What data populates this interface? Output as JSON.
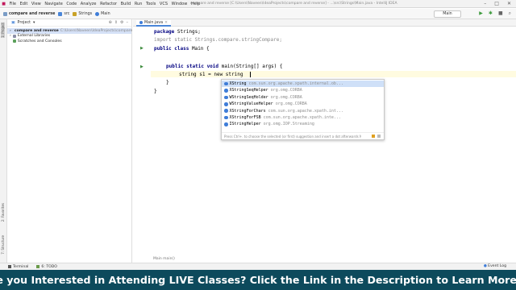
{
  "titlebar": {
    "menu": [
      "File",
      "Edit",
      "View",
      "Navigate",
      "Code",
      "Analyze",
      "Refactor",
      "Build",
      "Run",
      "Tools",
      "VCS",
      "Window",
      "Help"
    ],
    "window_title": "compare and reverse [C:\\Users\\Naveen\\IdeaProjects\\compare and reverse] - ...\\src\\Strings\\Main.java - IntelliJ IDEA"
  },
  "navbar": {
    "crumbs": [
      "compare and reverse",
      "src",
      "Strings",
      "Main"
    ],
    "run_config": "Main"
  },
  "left_tools": {
    "project": "1: Project",
    "structure": "7: Structure",
    "favorites": "2: Favorites"
  },
  "project_panel": {
    "header": "Project",
    "items": [
      {
        "label": "compare and reverse",
        "detail": "C:\\Users\\Naveen\\IdeaProjects\\compare and reverse",
        "selected": true
      },
      {
        "label": "External Libraries"
      },
      {
        "label": "Scratches and Consoles"
      }
    ]
  },
  "editor": {
    "tab_label": "Main.java",
    "code": {
      "line1_kw": "package",
      "line1_rest": " Strings;",
      "line2": "import static Strings.compare.stringCompare;",
      "line3_kw": "public class",
      "line3_rest": " Main {",
      "line4_kw": "public static void",
      "line4_rest": " main(String[] args) {",
      "line5": "string s1 = new string",
      "line6": "}",
      "line7": "}"
    }
  },
  "autocomplete": {
    "items": [
      {
        "name": "XString",
        "pkg": "com.sun.org.apache.xpath.internal.ob..."
      },
      {
        "name": "XStringSeqHelper",
        "pkg": "org.omg.CORBA"
      },
      {
        "name": "WStringSeqHolder",
        "pkg": "org.omg.CORBA"
      },
      {
        "name": "WStringValueHelper",
        "pkg": "org.omg.CORBA"
      },
      {
        "name": "XStringForChars",
        "pkg": "com.sun.org.apache.xpath.int..."
      },
      {
        "name": "XStringForFSB",
        "pkg": "com.sun.org.apache.xpath.inte..."
      },
      {
        "name": "IStringHelper",
        "pkg": "org.omg.IOP.Streaming"
      }
    ],
    "footer": "Press Ctrl+. to choose the selected (or first) suggestion and insert a dot afterwards  Next Tip"
  },
  "editor_breadcrumb": "Main  main()",
  "bottombar": {
    "terminal": "Terminal",
    "todo": "6: TODO",
    "event_log": "Event Log"
  },
  "banner": {
    "text": "Are you Interested in Attending LIVE Classes? Click the Link in the Description to Learn More.",
    "arrow": "⬇"
  },
  "colors": {
    "banner_bg": "#0d4a5c",
    "selection": "#d5e1f7",
    "accent": "#4a86d8"
  }
}
